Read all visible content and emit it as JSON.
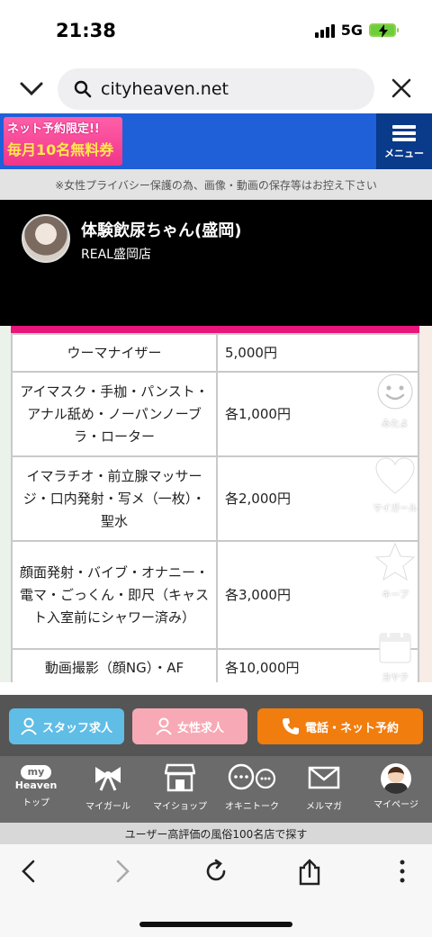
{
  "status": {
    "time": "21:38",
    "network": "5G"
  },
  "browser": {
    "url": "cityheaven.net"
  },
  "banner": {
    "promo_line1": "ネット予約限定!!",
    "promo_line2": "毎月10名無料券",
    "menu_label": "メニュー"
  },
  "notice": "※女性プライバシー保護の為、画像・動画の保存等はお控え下さい",
  "profile": {
    "name": "体験飲尿ちゃん(盛岡)",
    "shop": "REAL盛岡店"
  },
  "options": [
    {
      "name": "ウーマナイザー",
      "price": "5,000円"
    },
    {
      "name": "アイマスク・手枷・パンスト・アナル舐め・ノーパンノーブラ・ローター",
      "price": "各1,000円"
    },
    {
      "name": "イマラチオ・前立腺マッサージ・口内発射・写メ（一枚）・聖水",
      "price": "各2,000円"
    },
    {
      "name": "顔面発射・バイブ・オナニー・電マ・ごっくん・即尺（キャスト入室前にシャワー済み）",
      "price": "各3,000円"
    },
    {
      "name": "動画撮影（顔NG）・AF",
      "price": "各10,000円"
    }
  ],
  "fabs": {
    "mitayo": "みたよ",
    "mygirl": "マイガール",
    "keep": "キープ",
    "yoyaku": "ヨヤク"
  },
  "cta": {
    "staff": "スタッフ求人",
    "female": "女性求人",
    "call": "電話・ネット予約"
  },
  "tabs": {
    "top": "トップ",
    "logo_line1": "my",
    "logo_line2": "Heaven",
    "mygirl": "マイガール",
    "myshop": "マイショップ",
    "okini": "オキニトーク",
    "mail": "メルマガ",
    "mypage": "マイページ"
  },
  "ranking": "ユーザー高評価の風俗100名店で探す"
}
